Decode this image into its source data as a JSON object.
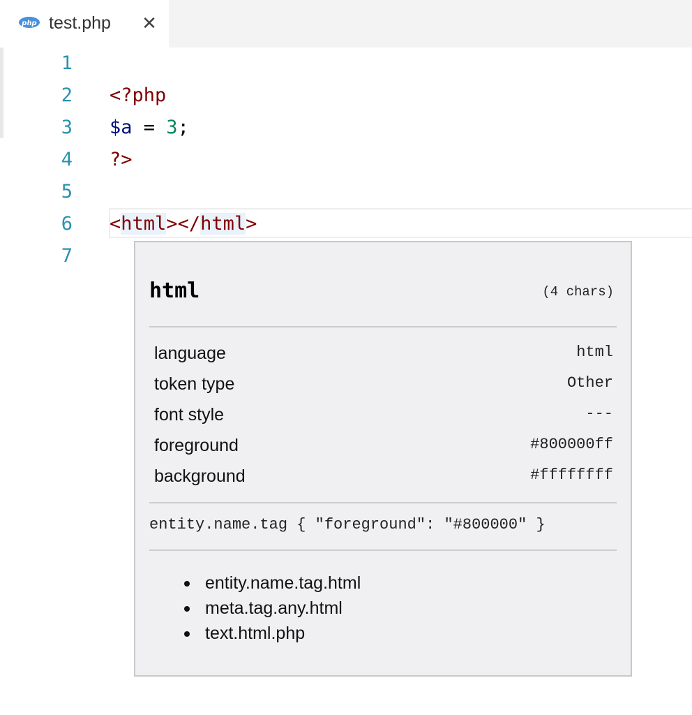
{
  "tab": {
    "icon": "php-file-icon",
    "icon_text": "php",
    "title": "test.php",
    "close_glyph": "✕"
  },
  "editor": {
    "line_numbers": [
      "1",
      "2",
      "3",
      "4",
      "5",
      "6",
      "7"
    ],
    "lines": {
      "l2": {
        "open_tag": "<?php"
      },
      "l3": {
        "var": "$a",
        "op": " = ",
        "num": "3",
        "semi": ";"
      },
      "l4": {
        "close_tag": "?>"
      },
      "l6": {
        "lt1": "<",
        "name1": "html",
        "gt1": ">",
        "lt2": "</",
        "name2": "html",
        "gt2": ">"
      }
    }
  },
  "hover": {
    "token": "html",
    "length": "(4 chars)",
    "properties": [
      {
        "key": "language",
        "value": "html"
      },
      {
        "key": "token type",
        "value": "Other"
      },
      {
        "key": "font style",
        "value": "---"
      },
      {
        "key": "foreground",
        "value": "#800000ff"
      },
      {
        "key": "background",
        "value": "#ffffffff"
      }
    ],
    "theme_rule": "entity.name.tag { \"foreground\": \"#800000\" }",
    "scopes": [
      "entity.name.tag.html",
      "meta.tag.any.html",
      "text.html.php"
    ]
  },
  "colors": {
    "tag": "#800000",
    "variable": "#001080",
    "number": "#09885a",
    "line_number": "#2b91af",
    "hover_bg": "#f0f0f2"
  }
}
